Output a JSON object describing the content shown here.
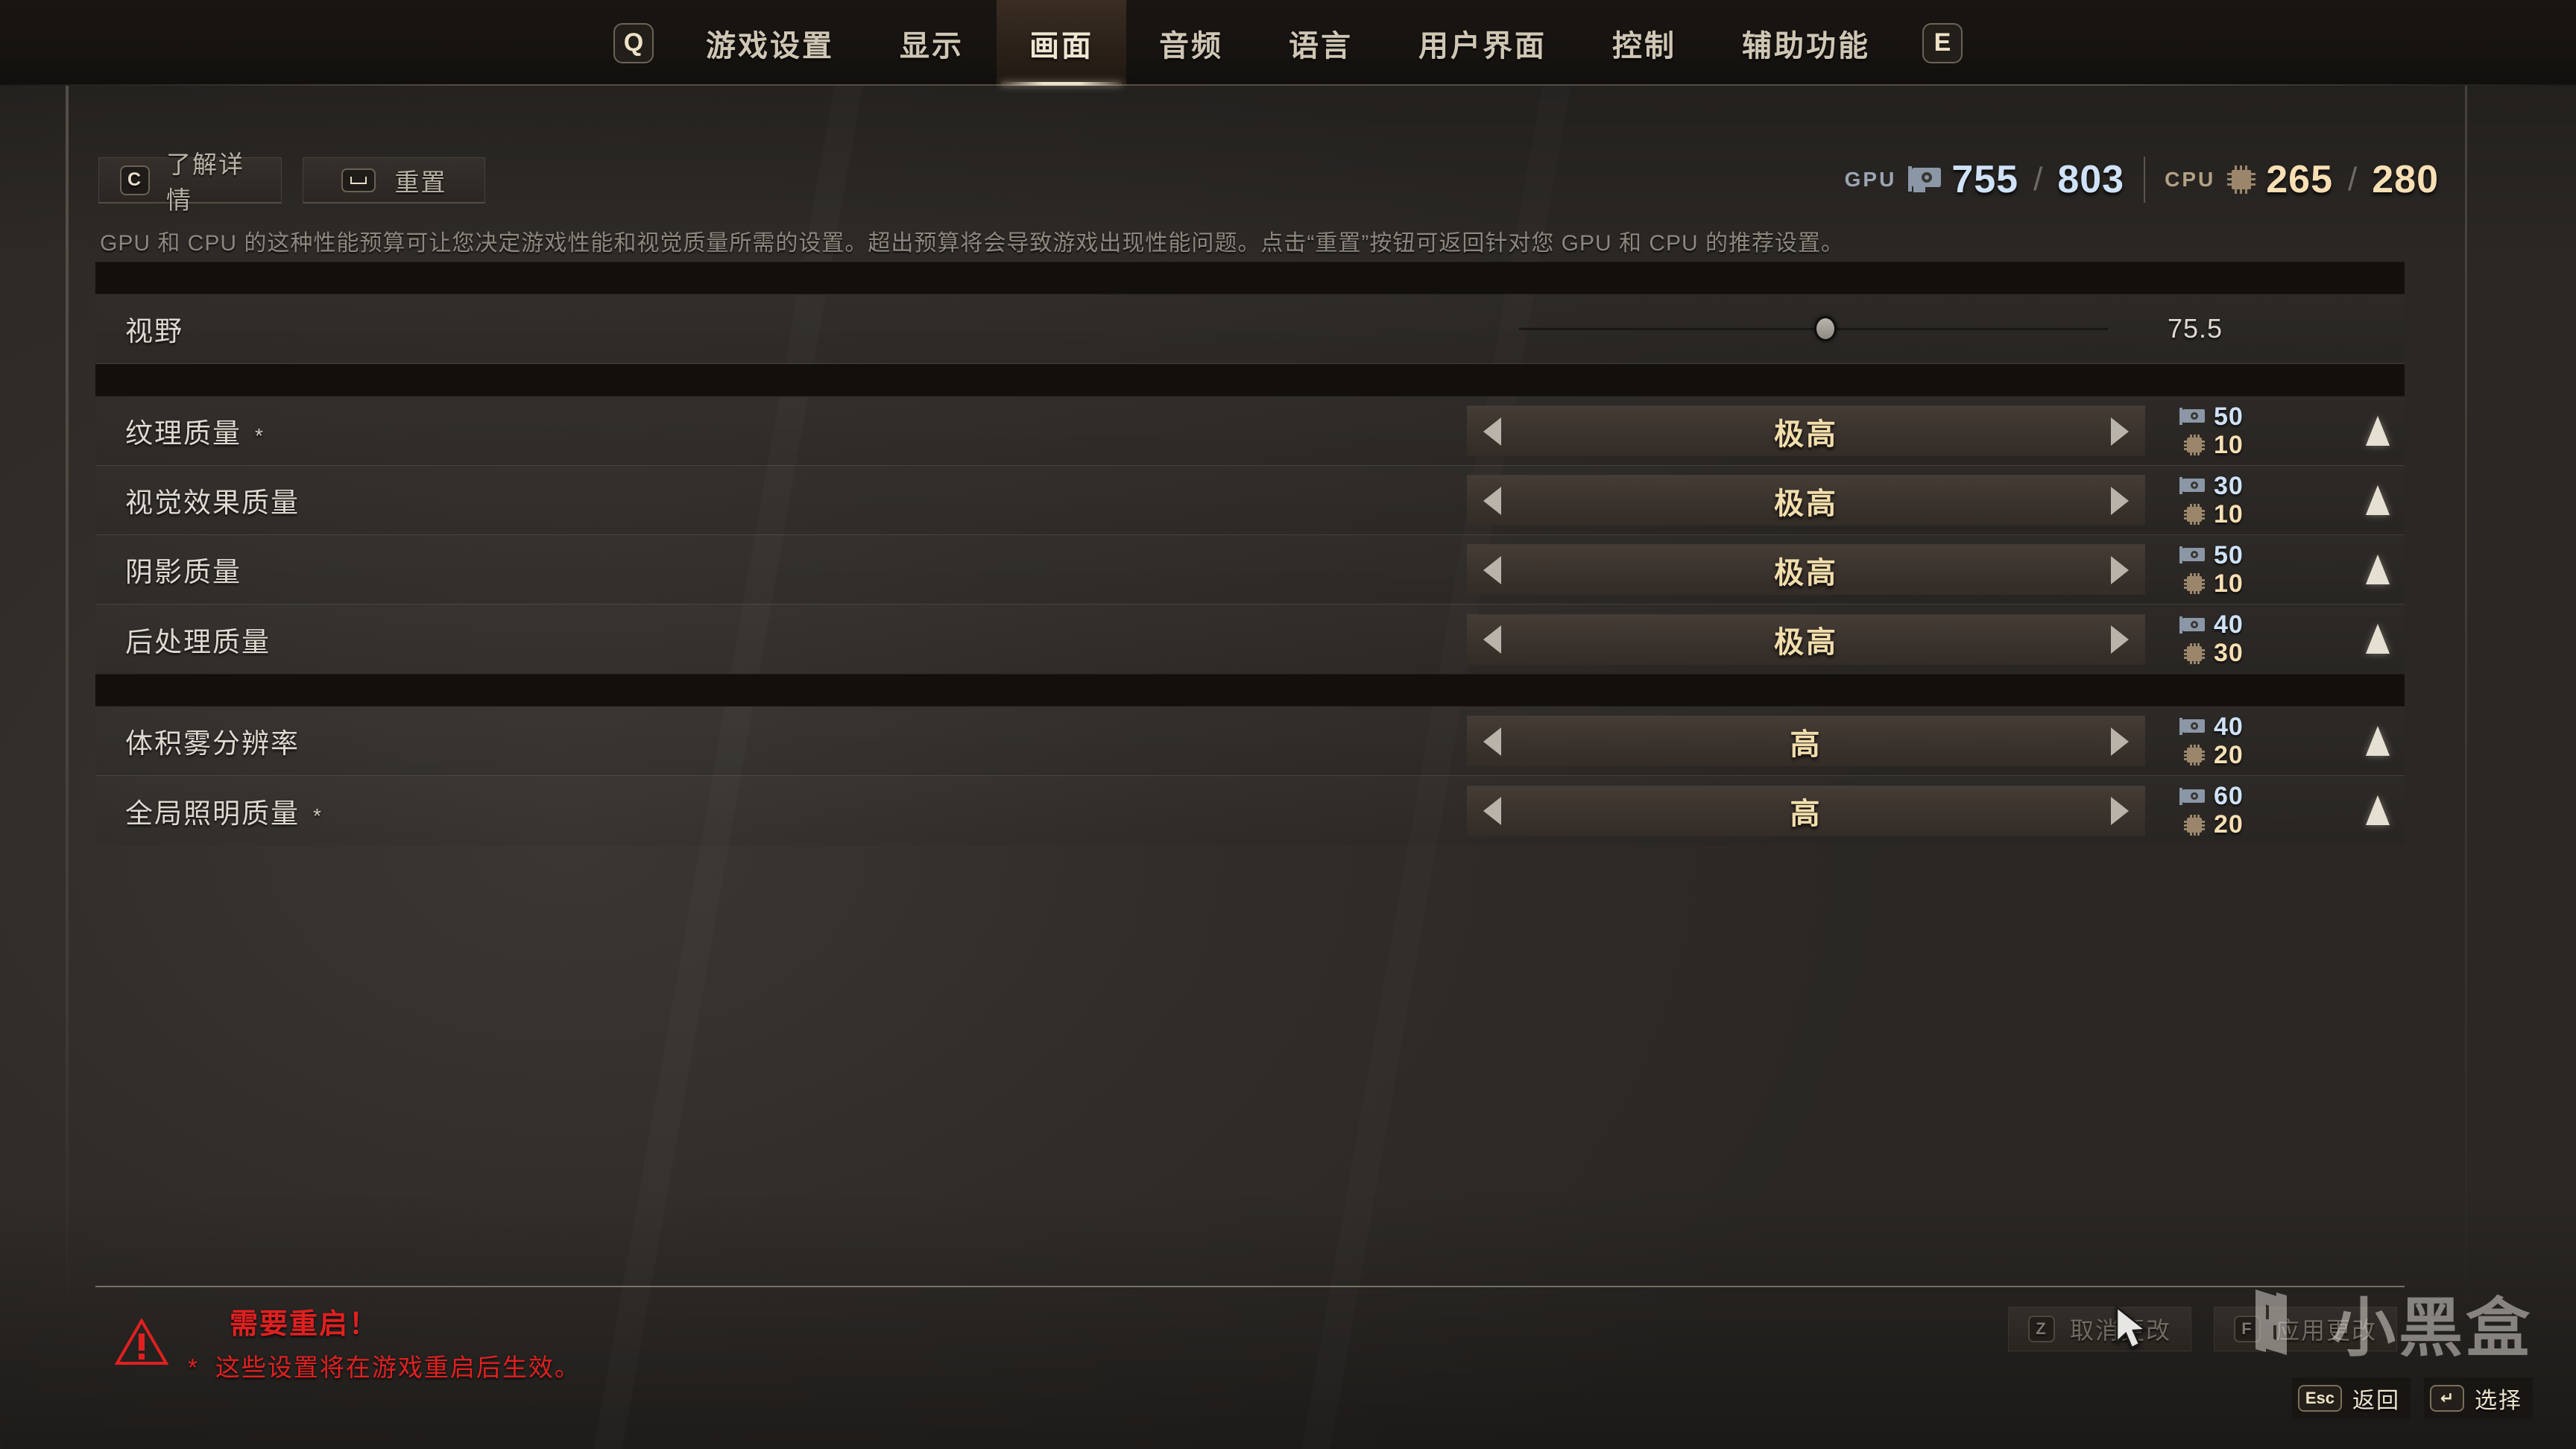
{
  "topbar": {
    "left_key": "Q",
    "right_key": "E",
    "tabs": [
      {
        "label": "游戏设置",
        "active": false
      },
      {
        "label": "显示",
        "active": false
      },
      {
        "label": "画面",
        "active": true
      },
      {
        "label": "音频",
        "active": false
      },
      {
        "label": "语言",
        "active": false
      },
      {
        "label": "用户界面",
        "active": false
      },
      {
        "label": "控制",
        "active": false
      },
      {
        "label": "辅助功能",
        "active": false
      }
    ]
  },
  "header": {
    "learn_more": {
      "key": "C",
      "label": "了解详情"
    },
    "reset": {
      "key": "⌐",
      "label": "重置"
    }
  },
  "budget": {
    "gpu_tag": "GPU",
    "gpu_used": "755",
    "gpu_total": "803",
    "cpu_tag": "CPU",
    "cpu_used": "265",
    "cpu_total": "280",
    "separator": "/",
    "gpu_color": "#cfe2f7",
    "cpu_color": "#f8dfb4"
  },
  "description": "GPU 和 CPU 的这种性能预算可让您决定游戏性能和视觉质量所需的设置。超出预算将会导致游戏出现性能问题。点击“重置”按钮可返回针对您 GPU 和 CPU 的推荐设置。",
  "settings": {
    "fov": {
      "label": "视野",
      "value": "75.5",
      "knob_percent": 52
    },
    "rows": [
      {
        "label": "纹理质量",
        "restart": "*",
        "value": "极高",
        "gpu": "50",
        "cpu": "10"
      },
      {
        "label": "视觉效果质量",
        "restart": "",
        "value": "极高",
        "gpu": "30",
        "cpu": "10"
      },
      {
        "label": "阴影质量",
        "restart": "",
        "value": "极高",
        "gpu": "50",
        "cpu": "10"
      },
      {
        "label": "后处理质量",
        "restart": "",
        "value": "极高",
        "gpu": "40",
        "cpu": "30"
      }
    ],
    "rows2": [
      {
        "label": "体积雾分辨率",
        "restart": "",
        "value": "高",
        "gpu": "40",
        "cpu": "20"
      },
      {
        "label": "全局照明质量",
        "restart": "*",
        "value": "高",
        "gpu": "60",
        "cpu": "20"
      }
    ]
  },
  "warning": {
    "title": "需要重启！",
    "marker": "*",
    "text": "这些设置将在游戏重启后生效。",
    "color": "#e02020"
  },
  "bottom_actions": {
    "discard": {
      "key": "Z",
      "label": "取消更改"
    },
    "apply": {
      "key": "F",
      "label": "应用更改"
    }
  },
  "watermark": {
    "text": "小黑盒"
  },
  "hints": [
    {
      "key": "Esc",
      "label": "返回"
    },
    {
      "key": "↵",
      "label": "选择"
    }
  ]
}
